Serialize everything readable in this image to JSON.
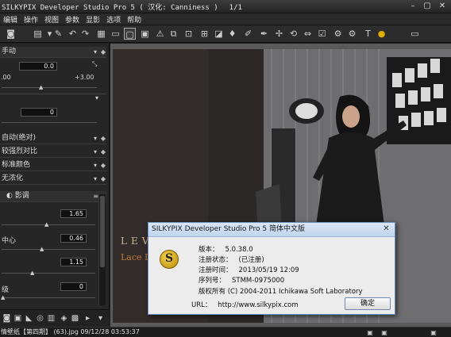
{
  "window": {
    "title": "SILKYPIX Developer Studio Pro 5 ( 汉化: Canniness )",
    "page_counter": "1/1"
  },
  "menu": [
    "编辑",
    "操作",
    "视图",
    "参数",
    "显影",
    "选项",
    "帮助"
  ],
  "panel": {
    "mode_label": "手动",
    "exposure_value": "0.0",
    "range_min": ".00",
    "range_max": "+3.00",
    "second_value": "0",
    "rows": [
      "自动(绝对)",
      "较强烈对比",
      "标准颜色",
      "无浓化"
    ],
    "shadow_label": "影调",
    "value_a": "1.65",
    "center_label": "中心",
    "value_b": "0.46",
    "value_c": "1.15",
    "level_label": "级",
    "value_d": "0"
  },
  "preview": {
    "brand_text": "LEVE",
    "subtitle_text": "Lace D"
  },
  "dialog": {
    "title": "SILKYPIX Developer Studio Pro 5 简体中文版",
    "version_label": "版本：",
    "version_value": "5.0.38.0",
    "reg_status_label": "注册状态：",
    "reg_status_value": "(已注册)",
    "reg_time_label": "注册时间：",
    "reg_time_value": "2013/05/19 12:09",
    "serial_label": "序列号：",
    "serial_value": "STMM-0975000",
    "copyright": "版权所有 (C) 2004-2011 Ichikawa Soft Laboratory",
    "url_label": "URL：",
    "url_value": "http://www.silkypix.com",
    "ok_label": "确定"
  },
  "status": {
    "text": "情壁纸【第四期】 (63).jpg 09/12/28 03:53:37"
  },
  "colors": {
    "accent": "#e0b000",
    "dialog_border": "#6a8fc0",
    "panel_bg": "#262626"
  }
}
